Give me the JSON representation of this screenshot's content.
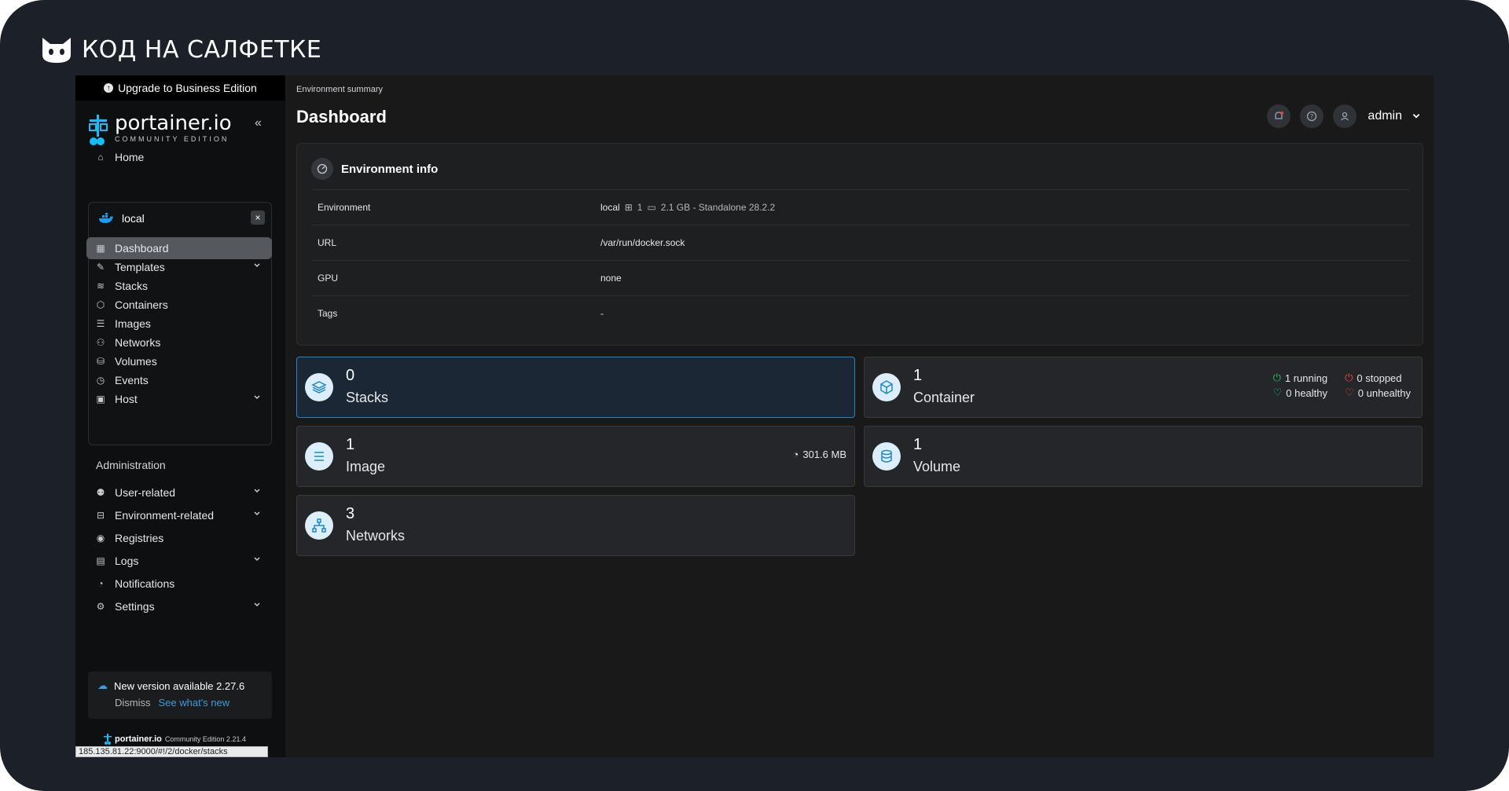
{
  "brand": {
    "text": "КОД НА САЛФЕТКЕ"
  },
  "sidebar": {
    "upgrade_label": "Upgrade to Business Edition",
    "logo_word": "portainer.io",
    "logo_sub": "COMMUNITY EDITION",
    "home_label": "Home",
    "environment_name": "local",
    "env_items": [
      {
        "label": "Dashboard",
        "icon": "dashboard-icon",
        "active": true
      },
      {
        "label": "Templates",
        "icon": "edit-icon",
        "expandable": true
      },
      {
        "label": "Stacks",
        "icon": "layers-icon"
      },
      {
        "label": "Containers",
        "icon": "box-icon"
      },
      {
        "label": "Images",
        "icon": "list-icon"
      },
      {
        "label": "Networks",
        "icon": "network-icon"
      },
      {
        "label": "Volumes",
        "icon": "database-icon"
      },
      {
        "label": "Events",
        "icon": "clock-icon"
      },
      {
        "label": "Host",
        "icon": "host-icon",
        "expandable": true
      }
    ],
    "admin_label": "Administration",
    "admin_items": [
      {
        "label": "User-related",
        "icon": "users-icon",
        "expandable": true
      },
      {
        "label": "Environment-related",
        "icon": "drive-icon",
        "expandable": true
      },
      {
        "label": "Registries",
        "icon": "radio-icon"
      },
      {
        "label": "Logs",
        "icon": "file-icon",
        "expandable": true
      },
      {
        "label": "Notifications",
        "icon": "bell-icon"
      },
      {
        "label": "Settings",
        "icon": "gear-icon",
        "expandable": true
      }
    ],
    "update": {
      "message": "New version available 2.27.6",
      "dismiss": "Dismiss",
      "link": "See what's new"
    },
    "footer_brand": "portainer.io",
    "footer_version": "Community Edition  2.21.4",
    "status_url": "185.135.81.22:9000/#!/2/docker/stacks"
  },
  "header": {
    "breadcrumb": "Environment summary",
    "title": "Dashboard",
    "user": "admin"
  },
  "env_info": {
    "title": "Environment info",
    "rows": [
      {
        "key": "Environment",
        "value": "local",
        "cpu": "1",
        "mem": "2.1 GB - Standalone 28.2.2"
      },
      {
        "key": "URL",
        "value": "/var/run/docker.sock"
      },
      {
        "key": "GPU",
        "value": "none"
      },
      {
        "key": "Tags",
        "value": "-"
      }
    ]
  },
  "tiles": {
    "stacks": {
      "count": "0",
      "label": "Stacks"
    },
    "container": {
      "count": "1",
      "label": "Container",
      "running": "1 running",
      "stopped": "0 stopped",
      "healthy": "0 healthy",
      "unhealthy": "0 unhealthy"
    },
    "image": {
      "count": "1",
      "label": "Image",
      "size": "301.6 MB"
    },
    "volume": {
      "count": "1",
      "label": "Volume"
    },
    "networks": {
      "count": "3",
      "label": "Networks"
    }
  },
  "colors": {
    "accent": "#1e88c7",
    "running": "#22c55e",
    "stopped": "#ef4444",
    "notify": "#ef4444"
  }
}
